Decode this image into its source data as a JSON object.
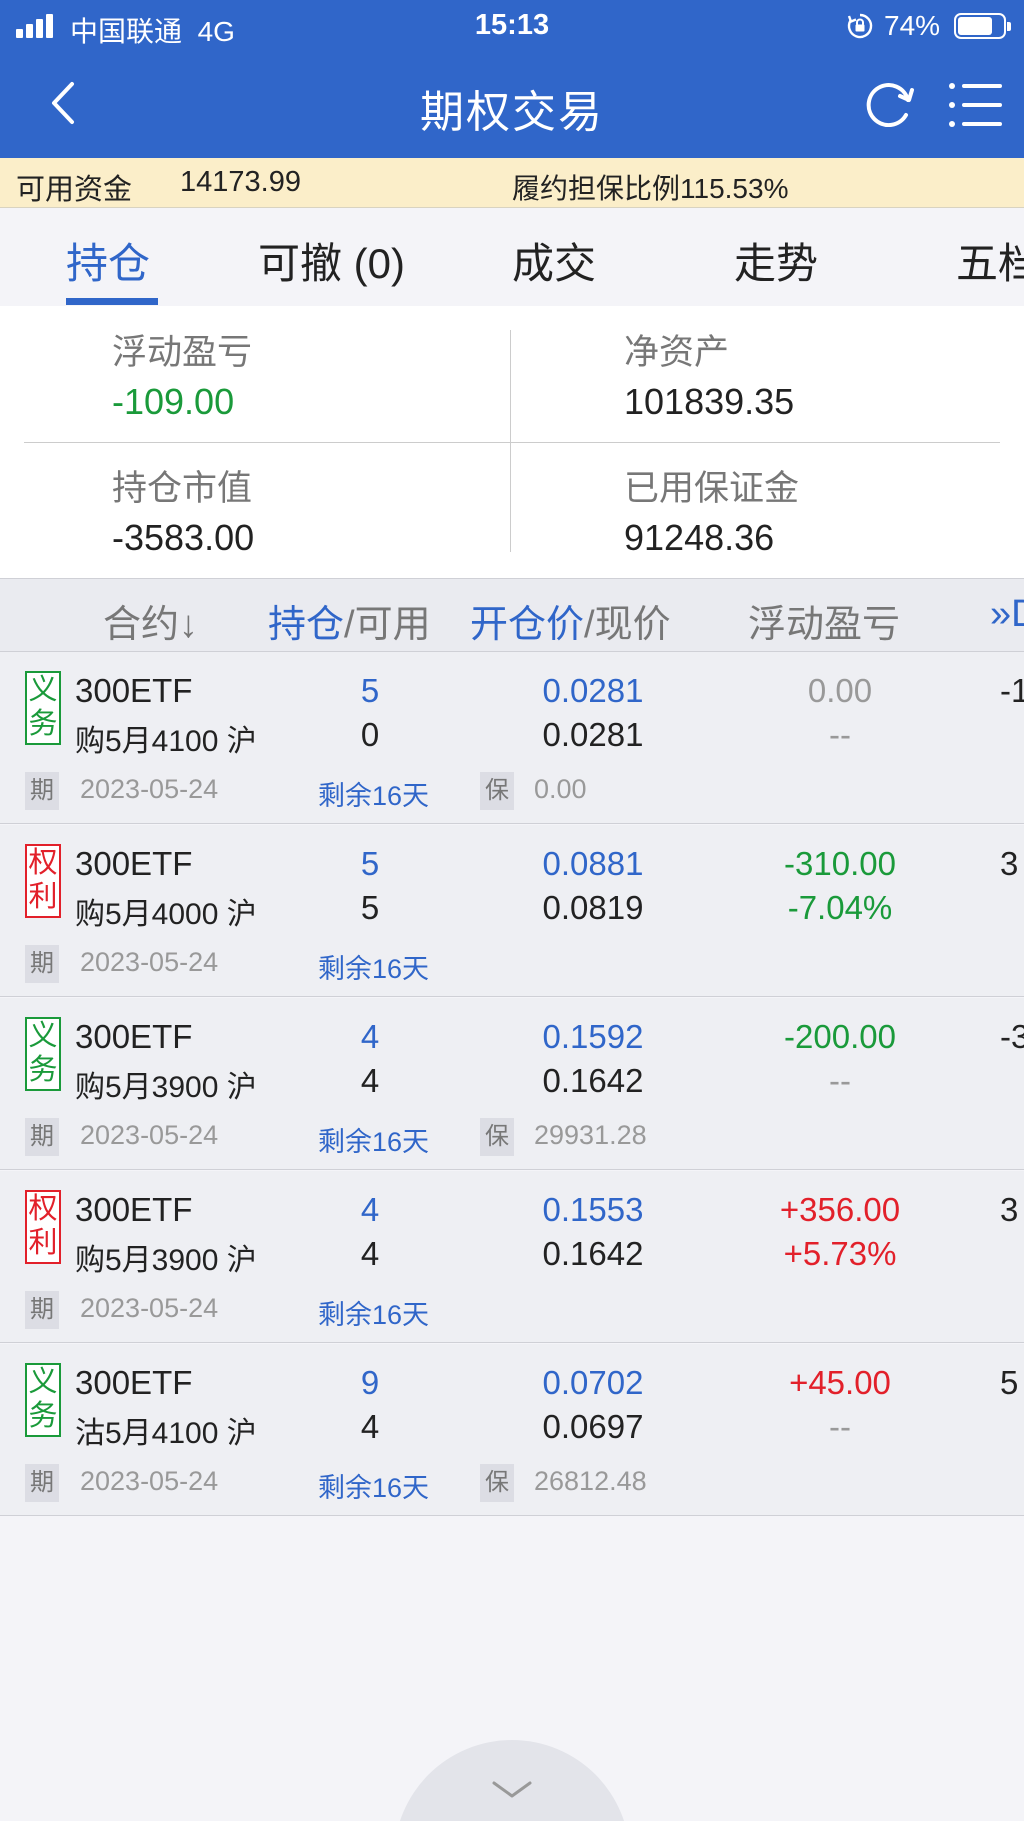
{
  "status": {
    "carrier": "中国联通",
    "network": "4G",
    "time": "15:13",
    "battery": "74%"
  },
  "nav": {
    "title": "期权交易"
  },
  "funds": {
    "label": "可用资金",
    "value": "14173.99",
    "ratio_label": "履约担保比例",
    "ratio_value": "115.53%"
  },
  "tabs": [
    {
      "label": "持仓"
    },
    {
      "label": "可撤 (0)"
    },
    {
      "label": "成交"
    },
    {
      "label": "走势"
    },
    {
      "label": "五档"
    }
  ],
  "summary": {
    "floating_pl_label": "浮动盈亏",
    "floating_pl_value": "-109.00",
    "net_assets_label": "净资产",
    "net_assets_value": "101839.35",
    "market_value_label": "持仓市值",
    "market_value_value": "-3583.00",
    "used_margin_label": "已用保证金",
    "used_margin_value": "91248.36"
  },
  "table_header": {
    "contract": "合约↓",
    "position": "持仓",
    "available": "/可用",
    "open_price": "开仓价",
    "current_price": "/现价",
    "floating_pl": "浮动盈亏",
    "more": "»D"
  },
  "labels": {
    "expiry_tag": "期",
    "margin_tag": "保"
  },
  "rows": [
    {
      "badge": "义\n务",
      "type": "duty",
      "name": "300ETF",
      "contract": "购5月4100 沪",
      "position": "5",
      "available": "0",
      "open_price": "0.0281",
      "current_price": "0.0281",
      "pl": "0.00",
      "pl_pct": "--",
      "pl_color": "gray",
      "edge": "-1",
      "expiry": "2023-05-24",
      "remain": "剩余16天",
      "margin": "0.00"
    },
    {
      "badge": "权\n利",
      "type": "right",
      "name": "300ETF",
      "contract": "购5月4000 沪",
      "position": "5",
      "available": "5",
      "open_price": "0.0881",
      "current_price": "0.0819",
      "pl": "-310.00",
      "pl_pct": "-7.04%",
      "pl_color": "green",
      "edge": "3",
      "expiry": "2023-05-24",
      "remain": "剩余16天",
      "margin": ""
    },
    {
      "badge": "义\n务",
      "type": "duty",
      "name": "300ETF",
      "contract": "购5月3900 沪",
      "position": "4",
      "available": "4",
      "open_price": "0.1592",
      "current_price": "0.1642",
      "pl": "-200.00",
      "pl_pct": "--",
      "pl_color": "green",
      "edge": "-3",
      "expiry": "2023-05-24",
      "remain": "剩余16天",
      "margin": "29931.28"
    },
    {
      "badge": "权\n利",
      "type": "right",
      "name": "300ETF",
      "contract": "购5月3900 沪",
      "position": "4",
      "available": "4",
      "open_price": "0.1553",
      "current_price": "0.1642",
      "pl": "+356.00",
      "pl_pct": "+5.73%",
      "pl_color": "red",
      "edge": "3",
      "expiry": "2023-05-24",
      "remain": "剩余16天",
      "margin": ""
    },
    {
      "badge": "义\n务",
      "type": "duty",
      "name": "300ETF",
      "contract": "沽5月4100 沪",
      "position": "9",
      "available": "4",
      "open_price": "0.0702",
      "current_price": "0.0697",
      "pl": "+45.00",
      "pl_pct": "--",
      "pl_color": "red",
      "edge": "5",
      "expiry": "2023-05-24",
      "remain": "剩余16天",
      "margin": "26812.48"
    }
  ],
  "icons": {
    "back": "chevron-left-icon",
    "refresh": "refresh-icon",
    "menu": "list-menu-icon",
    "pull": "chevron-down-icon",
    "lock": "rotation-lock-icon",
    "signal": "signal-icon",
    "battery": "battery-icon"
  },
  "colors": {
    "brand": "#3066c9",
    "gain": "#e2202a",
    "loss": "#1a9a3a",
    "funds_bar": "#fbeec9"
  }
}
